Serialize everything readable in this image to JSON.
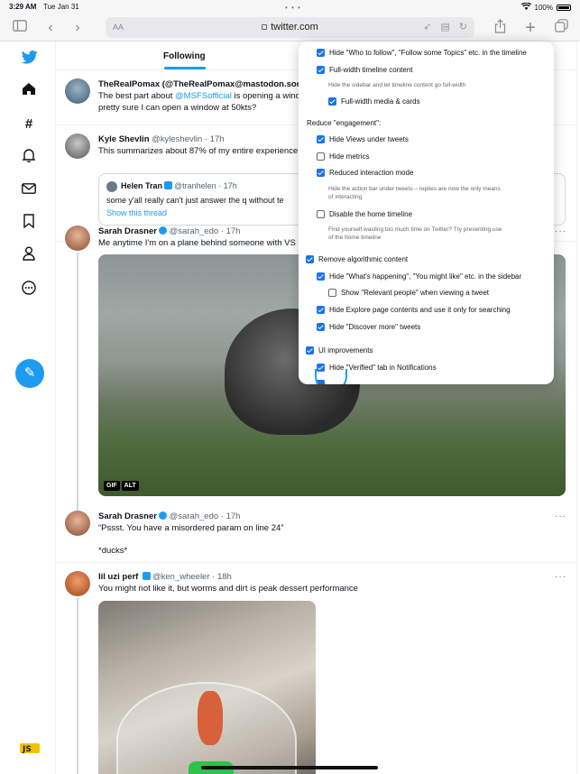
{
  "status": {
    "time": "3:29 AM",
    "date": "Tue Jan 31",
    "battery": "100%"
  },
  "browser": {
    "url": "twitter.com",
    "text_size": "AA"
  },
  "feed": {
    "tab": "Following",
    "pill": "Se",
    "tweets": [
      {
        "name": "TheRealPomax (@TheRealPomax@mastodon.soc",
        "handle": "",
        "time": "",
        "text_a": "The best part about ",
        "mention": "@MSFSofficial",
        "text_b": " is opening a wind",
        "text_c": "pretty sure I can open a window at 50kts?"
      },
      {
        "name": "Kyle Shevlin",
        "handle": "@kyleshevlin · 17h",
        "text": "This summarizes about 87% of my entire experience",
        "quote": {
          "name": "Helen Tran",
          "handle": "@tranhelen · 17h",
          "text": "some y'all really can't just answer the q without te",
          "link": "Show this thread"
        }
      },
      {
        "name": "Sarah Drasner",
        "handle": "@sarah_edo · 17h",
        "text": "Me anytime I'm on a plane behind someone with VS",
        "badges": [
          "GIF",
          "ALT"
        ]
      },
      {
        "name": "Sarah Drasner",
        "handle": "@sarah_edo · 17h",
        "text": "“Pssst. You have a misordered param on line 24”",
        "text2": "*ducks*"
      },
      {
        "name": "lil uzi perf",
        "handle": "@ken_wheeler · 18h",
        "text": "You might not like it, but worms and dirt is peak dessert performance"
      }
    ]
  },
  "settings": {
    "items": [
      {
        "label": "Hide \"Who to follow\", \"Follow some Topics\" etc. in the timeline",
        "checked": true
      },
      {
        "label": "Full-width timeline content",
        "checked": true,
        "desc": "Hide the sidebar and let timeline content go full-width"
      },
      {
        "label": "Full-width media & cards",
        "checked": true
      },
      {
        "section": "Reduce \"engagement\":"
      },
      {
        "label": "Hide Views under tweets",
        "checked": true
      },
      {
        "label": "Hide metrics",
        "checked": false
      },
      {
        "label": "Reduced interaction mode",
        "checked": true,
        "desc_a": "Hide the action bar under tweets – replies are now the only means",
        "desc_b": "of interacting"
      },
      {
        "label": "Disable the home timeline",
        "checked": false,
        "desc_a": "Find yourself wasting too much time on Twitter? Try preventing use",
        "desc_b": "of the home timeline"
      },
      {
        "label": "Remove algorithmic content",
        "checked": true
      },
      {
        "label": "Hide \"What's happening\", \"You might like\" etc. in the sidebar",
        "checked": true
      },
      {
        "label": "Show \"Relevant people\" when viewing a tweet",
        "checked": false
      },
      {
        "label": "Hide Explore page contents and use it only for searching",
        "checked": true
      },
      {
        "label": "Hide \"Discover more\" tweets",
        "checked": true
      },
      {
        "label": "UI improvements",
        "checked": true
      },
      {
        "label": "Hide \"Verified\" tab in Notifications",
        "checked": true
      }
    ]
  },
  "icons": {
    "sidebar": "sidebar-toggle-icon",
    "back": "back-icon",
    "forward": "forward-icon",
    "share": "share-icon",
    "newtab": "plus-icon",
    "tabs": "tabs-icon"
  },
  "colors": {
    "accent": "#1d9bf0",
    "checkbox": "#1a73e8"
  }
}
